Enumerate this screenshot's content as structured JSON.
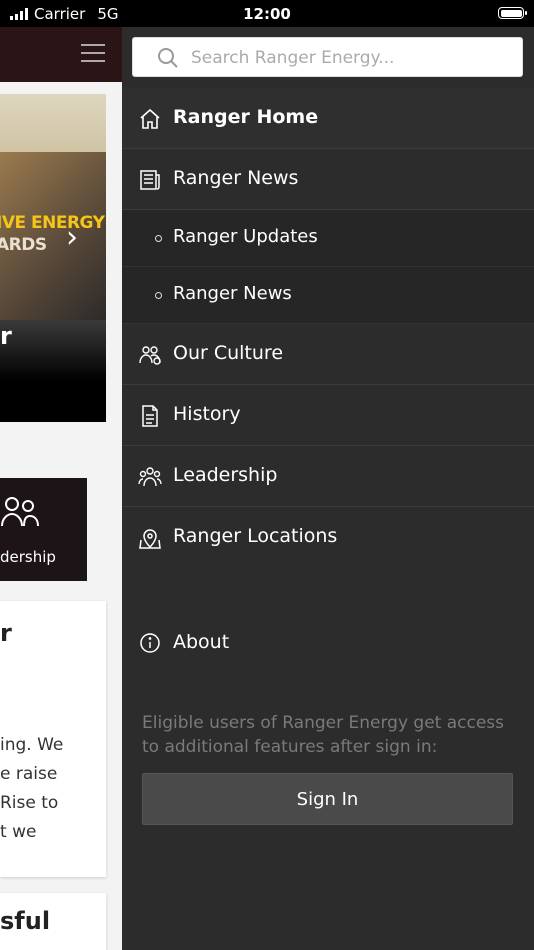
{
  "status_bar": {
    "carrier": "Carrier",
    "network": "5G",
    "time": "12:00"
  },
  "background_page": {
    "banner_overlay_line1": "IVE ENERGY",
    "banner_overlay_line2": "ARDS",
    "banner_caption": "r",
    "card_label": "dership",
    "card_heading": "r",
    "card_text": "ing. We\ne raise\nRise to\nt we",
    "card2_heading": "sful"
  },
  "drawer": {
    "search_placeholder": "Search Ranger Energy...",
    "menu": {
      "home": "Ranger Home",
      "news": "Ranger News",
      "sub_updates": "Ranger Updates",
      "sub_news": "Ranger News",
      "culture": "Our Culture",
      "history": "History",
      "leadership": "Leadership",
      "locations": "Ranger Locations"
    },
    "about": "About",
    "signin_note": "Eligible users of Ranger Energy get access to additional features after sign in:",
    "signin_button": "Sign In"
  },
  "colors": {
    "drawer_bg": "#2c2c2c",
    "header_bg": "#2a1416",
    "accent_yellow": "#f5c518"
  }
}
